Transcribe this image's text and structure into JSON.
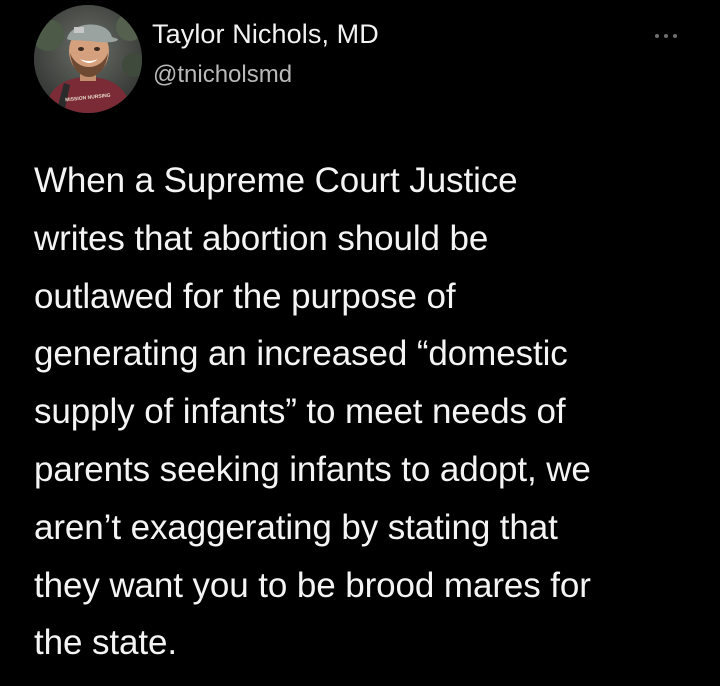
{
  "author": {
    "name": "Taylor Nichols, MD",
    "handle": "@tnicholsmd",
    "avatar_icon": "profile-photo",
    "shirt_text": "MISSION NURSING"
  },
  "menu": {
    "icon": "more-options-icon"
  },
  "tweet": {
    "lines": [
      "When a Supreme Court Justice",
      "writes that abortion should be",
      "outlawed for the purpose of",
      "generating an increased “domestic",
      "supply of infants” to meet needs of",
      "parents seeking infants to adopt, we",
      "aren’t exaggerating by stating that",
      "they want you to be brood mares for",
      "the state."
    ]
  },
  "colors": {
    "background": "#000000",
    "text": "#f4f4f4",
    "secondary": "#b9b9b9"
  }
}
